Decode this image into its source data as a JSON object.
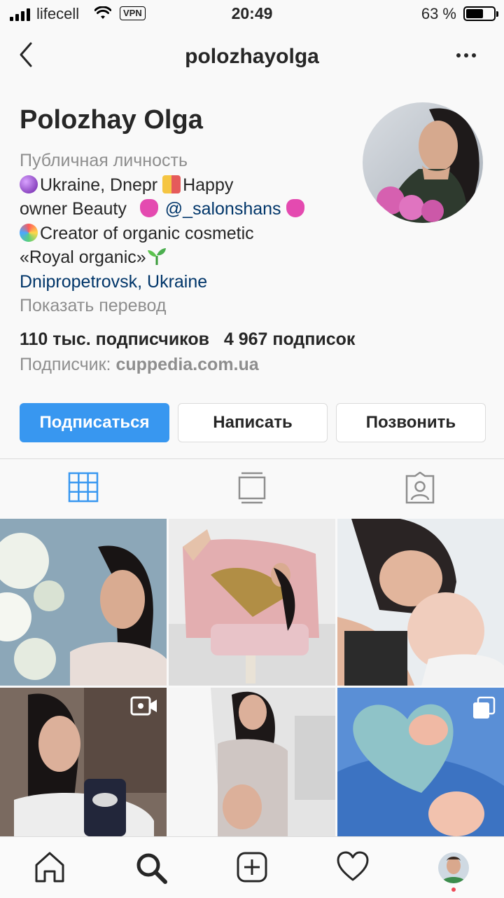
{
  "status_bar": {
    "carrier": "lifecell",
    "vpn": "VPN",
    "time": "20:49",
    "battery_text": "63 %",
    "battery_level": 0.63
  },
  "header": {
    "username": "polozhayolga",
    "back_icon": "chevron-left-icon",
    "more_icon": "more-horizontal-icon"
  },
  "profile": {
    "full_name": "Polozhay Olga",
    "category": "Публичная личность",
    "bio_line1_a": "Ukraine, Dnepr",
    "bio_line1_b": "Happy",
    "bio_line2_a": "owner Beauty",
    "bio_mention": "@_salonshans",
    "bio_line3": "Creator of organic cosmetic",
    "bio_line4": "«Royal organic»",
    "location": "Dnipropetrovsk, Ukraine",
    "translate": "Показать перевод",
    "followers": "110 тыс. подписчиков",
    "following": "4 967 подписок",
    "followed_by_label": "Подписчик:",
    "followed_by_name": "cuppedia.com.ua"
  },
  "actions": {
    "follow": "Подписаться",
    "message": "Написать",
    "call": "Позвонить"
  },
  "colors": {
    "accent": "#3897f0",
    "link": "#003569",
    "muted": "#8e8e8e",
    "text": "#262626"
  },
  "profile_tabs": [
    "grid-icon",
    "igtv-icon",
    "tagged-icon"
  ],
  "posts": [
    {
      "name": "post-1",
      "type": "photo"
    },
    {
      "name": "post-2",
      "type": "photo"
    },
    {
      "name": "post-3",
      "type": "photo"
    },
    {
      "name": "post-4",
      "type": "video"
    },
    {
      "name": "post-5",
      "type": "photo"
    },
    {
      "name": "post-6",
      "type": "carousel"
    }
  ],
  "tab_bar": [
    "home-icon",
    "search-icon",
    "new-post-icon",
    "activity-heart-icon",
    "profile-avatar"
  ]
}
